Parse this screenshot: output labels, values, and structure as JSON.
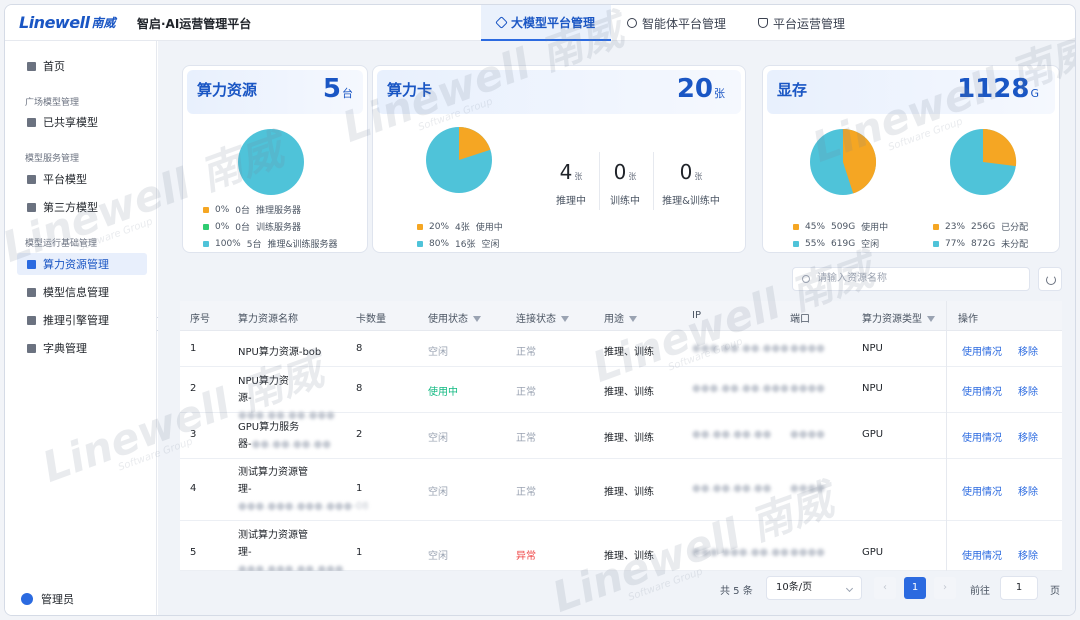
{
  "brand": {
    "logo_en": "Linewell",
    "logo_cn": "南威",
    "app_title": "智启·AI运营管理平台"
  },
  "top_tabs": [
    {
      "label": "大模型平台管理",
      "icon": "cube-icon",
      "active": true
    },
    {
      "label": "智能体平台管理",
      "icon": "smile-icon",
      "active": false
    },
    {
      "label": "平台运营管理",
      "icon": "shield-icon",
      "active": false
    }
  ],
  "sidebar": {
    "home": "首页",
    "group_square": "广场模型管理",
    "shared_models": "已共享模型",
    "group_service": "模型服务管理",
    "platform_models": "平台模型",
    "third_party_models": "第三方模型",
    "group_infra": "模型运行基础管理",
    "compute_mgmt": "算力资源管理",
    "model_info": "模型信息管理",
    "inference_engine": "推理引擎管理",
    "dictionary": "字典管理",
    "user": "管理员"
  },
  "cards": {
    "compute": {
      "title": "算力资源",
      "count": "5",
      "unit": "台",
      "legend": [
        {
          "pct": "0%",
          "amount": "0台",
          "label": "推理服务器",
          "color": "#f5a623"
        },
        {
          "pct": "0%",
          "amount": "0台",
          "label": "训练服务器",
          "color": "#2ecc71"
        },
        {
          "pct": "100%",
          "amount": "5台",
          "label": "推理&训练服务器",
          "color": "#4fc3d9"
        }
      ]
    },
    "gpu": {
      "title": "算力卡",
      "count": "20",
      "unit": "张",
      "stats": [
        {
          "num": "4",
          "unit": "张",
          "label": "推理中"
        },
        {
          "num": "0",
          "unit": "张",
          "label": "训练中"
        },
        {
          "num": "0",
          "unit": "张",
          "label": "推理&训练中"
        }
      ],
      "legend": [
        {
          "pct": "20%",
          "amount": "4张",
          "label": "使用中",
          "color": "#f5a623"
        },
        {
          "pct": "80%",
          "amount": "16张",
          "label": "空闲",
          "color": "#4fc3d9"
        }
      ]
    },
    "memory": {
      "title": "显存",
      "count": "1128",
      "unit": "G",
      "legend_a": [
        {
          "pct": "45%",
          "amount": "509G",
          "label": "使用中",
          "color": "#f5a623"
        },
        {
          "pct": "55%",
          "amount": "619G",
          "label": "空闲",
          "color": "#4fc3d9"
        }
      ],
      "legend_b": [
        {
          "pct": "23%",
          "amount": "256G",
          "label": "已分配",
          "color": "#f5a623"
        },
        {
          "pct": "77%",
          "amount": "872G",
          "label": "未分配",
          "color": "#4fc3d9"
        }
      ]
    }
  },
  "search": {
    "placeholder": "请输入资源名称"
  },
  "table": {
    "headers": [
      "序号",
      "算力资源名称",
      "卡数量",
      "使用状态",
      "连接状态",
      "用途",
      "IP",
      "端口",
      "算力资源类型",
      "操作"
    ],
    "rows": [
      {
        "no": "1",
        "name_a": "NPU算力资源-bob",
        "name_b": "",
        "name_c": "",
        "cards": "8",
        "use": "空闲",
        "conn": "正常",
        "purpose": "推理、训练",
        "ip": "●●●.●●.●●.●●●",
        "port": "●●●●",
        "type": "NPU"
      },
      {
        "no": "2",
        "name_a": "NPU算力资",
        "name_b": "源-",
        "name_c": "●●●.●●.●●.●●●",
        "cards": "8",
        "use": "使用中",
        "conn": "正常",
        "purpose": "推理、训练",
        "ip": "●●●.●●.●●.●●●",
        "port": "●●●●",
        "type": "NPU"
      },
      {
        "no": "3",
        "name_a": "GPU算力服务",
        "name_b": "器-",
        "name_c": "●●.●●.●●.●●",
        "cards": "2",
        "use": "空闲",
        "conn": "正常",
        "purpose": "推理、训练",
        "ip": "●●.●●.●●.●●",
        "port": "●●●●",
        "type": "GPU"
      },
      {
        "no": "4",
        "name_a": "测试算力资源管",
        "name_b": "理-",
        "name_c": "●●●.●●●.●●●.●●●-08",
        "cards": "1",
        "use": "空闲",
        "conn": "正常",
        "purpose": "推理、训练",
        "ip": "●●.●●.●●.●●",
        "port": "●●●●",
        "type": ""
      },
      {
        "no": "5",
        "name_a": "测试算力资源管",
        "name_b": "理-",
        "name_c": "●●●.●●●.●●.●●●",
        "cards": "1",
        "use": "空闲",
        "conn": "异常",
        "purpose": "推理、训练",
        "ip": "●●●.●●●.●●.●●",
        "port": "●●●●",
        "type": "GPU"
      }
    ],
    "action_usage": "使用情况",
    "action_remove": "移除"
  },
  "pagination": {
    "total": "共 5 条",
    "page_size": "10条/页",
    "current": "1",
    "goto": "前往",
    "goto_value": "1",
    "page_suffix": "页"
  },
  "watermark": {
    "text": "Linewell 南威",
    "sub": "Software Group"
  }
}
